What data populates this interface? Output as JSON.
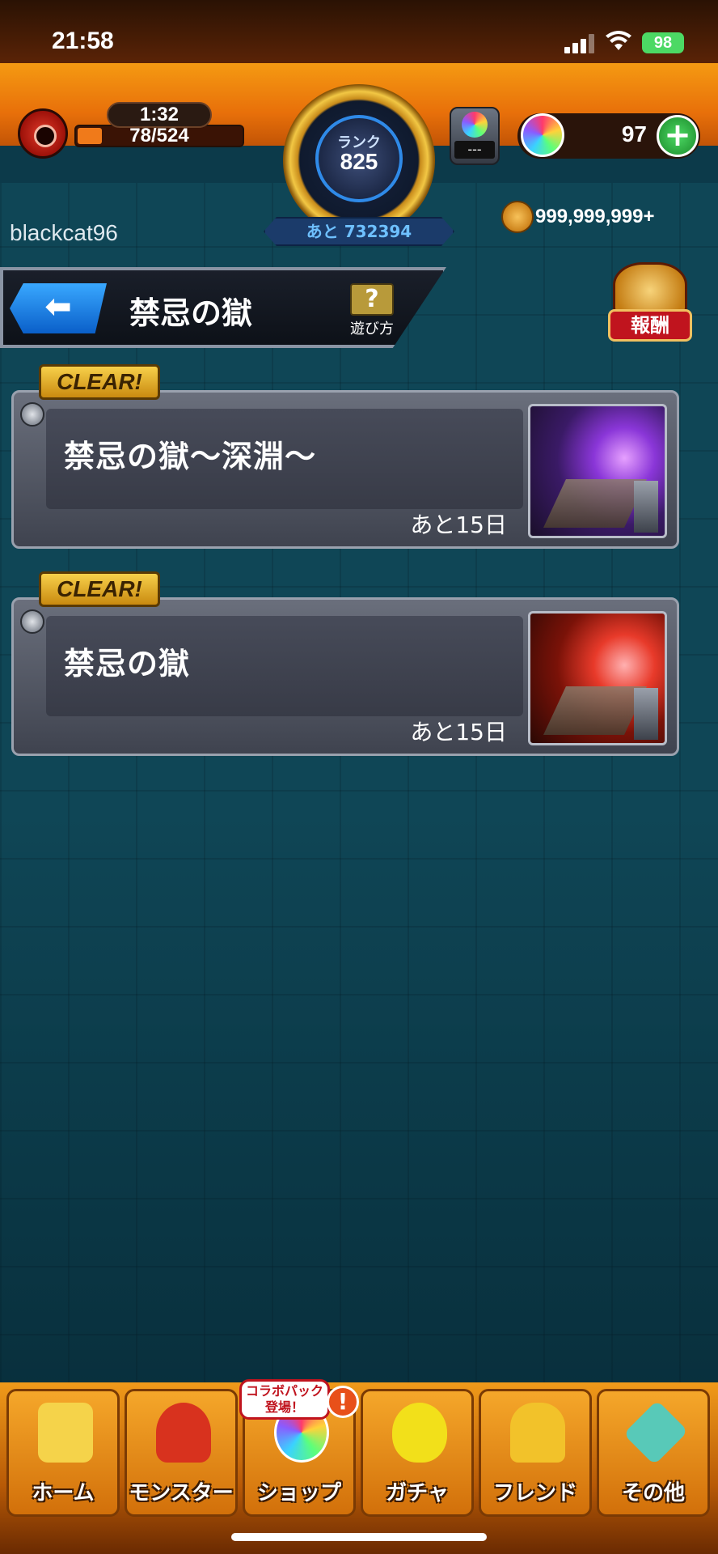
{
  "status_bar": {
    "time": "21:58",
    "battery": "98"
  },
  "header": {
    "stamina_timer": "1:32",
    "stamina": "78/524",
    "stamina_level": 0.15,
    "rank_label": "ランク",
    "rank_value": "825",
    "exp_remaining": "あと 732394",
    "orb_device_value": "---",
    "orb_count": "97",
    "plus_label": "+",
    "username": "blackcat96",
    "coins": "999,999,999+"
  },
  "title_bar": {
    "back_icon": "left-arrow-icon",
    "title": "禁忌の獄",
    "help_symbol": "?",
    "help_label": "遊び方",
    "reward_label": "報酬"
  },
  "quests": [
    {
      "badge": "CLEAR!",
      "name": "禁忌の獄～深淵～",
      "remaining": "あと15日",
      "theme": "purple"
    },
    {
      "badge": "CLEAR!",
      "name": "禁忌の獄",
      "remaining": "あと15日",
      "theme": "red"
    }
  ],
  "bottom_nav": {
    "items": [
      {
        "label": "ホーム",
        "icon": "home-icon",
        "color": "#f5d34a"
      },
      {
        "label": "モンスター",
        "icon": "monster-icon",
        "color": "#d8321e"
      },
      {
        "label": "ショップ",
        "icon": "shop-orb-icon",
        "color": "#ffffff"
      },
      {
        "label": "ガチャ",
        "icon": "gacha-egg-icon",
        "color": "#f2e01a"
      },
      {
        "label": "フレンド",
        "icon": "friends-icon",
        "color": "#f2c22a"
      },
      {
        "label": "その他",
        "icon": "other-icon",
        "color": "#58c9b8"
      }
    ],
    "collab_bubble": "コラボパック登場！",
    "alert": "!"
  }
}
